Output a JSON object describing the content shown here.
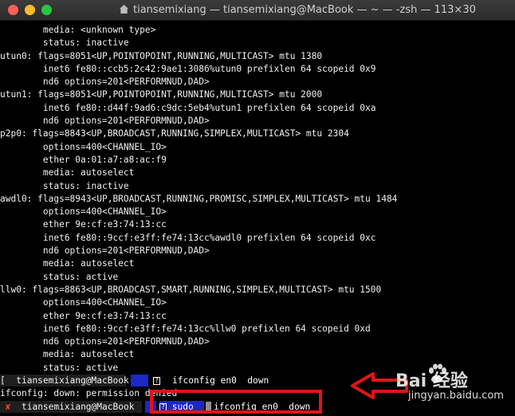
{
  "window": {
    "title": "tiansemixiang — tiansemixiang@MacBook — ~ — -zsh — 113×30",
    "icon": "home-folder-icon"
  },
  "output_lines": [
    "        media: <unknown type>",
    "        status: inactive",
    "utun0: flags=8051<UP,POINTOPOINT,RUNNING,MULTICAST> mtu 1380",
    "        inet6 fe80::ccb5:2c42:9ae1:3086%utun0 prefixlen 64 scopeid 0x9",
    "        nd6 options=201<PERFORMNUD,DAD>",
    "utun1: flags=8051<UP,POINTOPOINT,RUNNING,MULTICAST> mtu 2000",
    "        inet6 fe80::d44f:9ad6:c9dc:5eb4%utun1 prefixlen 64 scopeid 0xa",
    "        nd6 options=201<PERFORMNUD,DAD>",
    "p2p0: flags=8843<UP,BROADCAST,RUNNING,SIMPLEX,MULTICAST> mtu 2304",
    "        options=400<CHANNEL_IO>",
    "        ether 0a:01:a7:a8:ac:f9",
    "        media: autoselect",
    "        status: inactive",
    "awdl0: flags=8943<UP,BROADCAST,RUNNING,PROMISC,SIMPLEX,MULTICAST> mtu 1484",
    "        options=400<CHANNEL_IO>",
    "        ether 9e:cf:e3:74:13:cc",
    "        inet6 fe80::9ccf:e3ff:fe74:13cc%awdl0 prefixlen 64 scopeid 0xc",
    "        nd6 options=201<PERFORMNUD,DAD>",
    "        media: autoselect",
    "        status: active",
    "llw0: flags=8863<UP,BROADCAST,SMART,RUNNING,SIMPLEX,MULTICAST> mtu 1500",
    "        options=400<CHANNEL_IO>",
    "        ether 9e:cf:e3:74:13:cc",
    "        inet6 fe80::9ccf:e3ff:fe74:13cc%llw0 prefixlen 64 scopeid 0xd",
    "        nd6 options=201<PERFORMNUD,DAD>",
    "        media: autoselect",
    "        status: active"
  ],
  "prompt1": {
    "bracket": "[",
    "user_host": "tiansemixiang@MacBook",
    "dir_mark": "~",
    "icon": "question-box-icon",
    "command": "ifconfig en0  down"
  },
  "error_line": "ifconfig: down: permission denied",
  "prompt2": {
    "status_mark": "✘",
    "user_host": "tiansemixiang@MacBook",
    "icon": "question-box-icon",
    "command_sudo": "sudo",
    "command_rest": "ifconfig en0  down"
  },
  "watermark": {
    "brand": "Bai  经验",
    "domain": "jingyan.baidu.com"
  },
  "colors": {
    "prompt_blue": "#1d26c7",
    "highlight_red": "#e41313"
  }
}
